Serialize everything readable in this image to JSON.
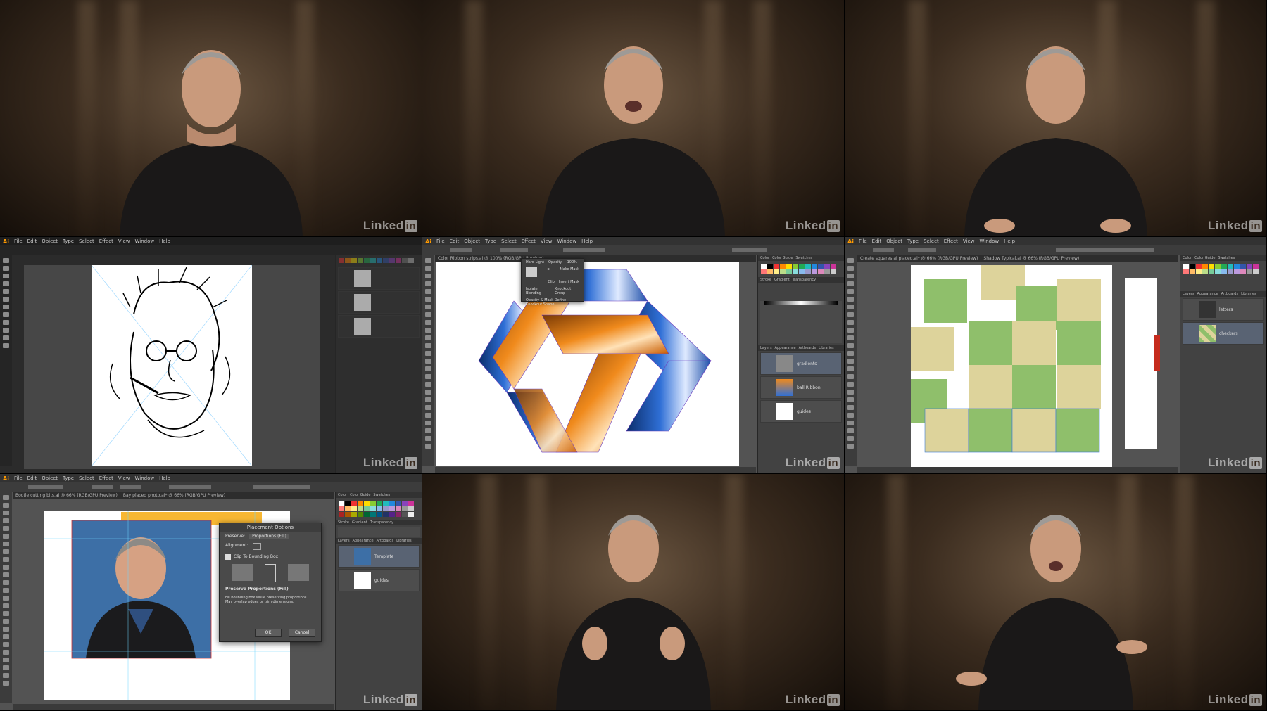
{
  "watermark": {
    "text": "Linked",
    "badge": "in"
  },
  "app": {
    "logo": "Ai",
    "menu": [
      "File",
      "Edit",
      "Object",
      "Type",
      "Select",
      "Effect",
      "View",
      "Window",
      "Help"
    ]
  },
  "tiles": {
    "tile2_doc_tab": "Color Ribbon strips.ai @ 100% (RGB/GPU Preview)",
    "tile2_popup": {
      "blend_mode": "Hard Light",
      "opacity_label": "Opacity:",
      "opacity_value": "100%",
      "make_mask": "Make Mask",
      "clip": "Clip",
      "invert_mask": "Invert Mask",
      "isolate_blending": "Isolate Blending",
      "knockout_group": "Knockout Group",
      "opacity_mask_note": "Opacity & Mask Define Knockout Shape"
    },
    "tile2_layers": [
      "gradients",
      "ball Ribbon",
      "guides"
    ],
    "tile3_doc_tabs": [
      "Create squares.ai placed.ai* @ 66% (RGB/GPU Preview)",
      "Shadow Typical.ai @ 66% (RGB/GPU Preview)"
    ],
    "tile3_layers": [
      "letters",
      "checkers"
    ],
    "tile4_doc_tabs": [
      "Bootle cutting bits.ai @ 66% (RGB/GPU Preview)",
      "Bay placed photo.ai* @ 66% (RGB/GPU Preview)"
    ],
    "tile4_layers": [
      "Template",
      "guides"
    ],
    "tile4_dialog": {
      "title": "Placement Options",
      "preserve_label": "Preserve:",
      "preserve_value": "Proportions (Fill)",
      "alignment_label": "Alignment:",
      "clip_label": "Clip To Bounding Box",
      "desc_title": "Preserve Proportions (Fill)",
      "desc_body": "Fill bounding box while preserving proportions. May overlap edges or trim dimensions.",
      "ok": "OK",
      "cancel": "Cancel"
    }
  },
  "colors": {
    "app_bg": "#535353",
    "orange": "#f08a1c",
    "blue": "#2f6fd6",
    "green": "#8fbf6b",
    "tan": "#ddd39b",
    "dialog_bg": "#4a4a4a",
    "cyan_guides": "#6fd6ff"
  }
}
